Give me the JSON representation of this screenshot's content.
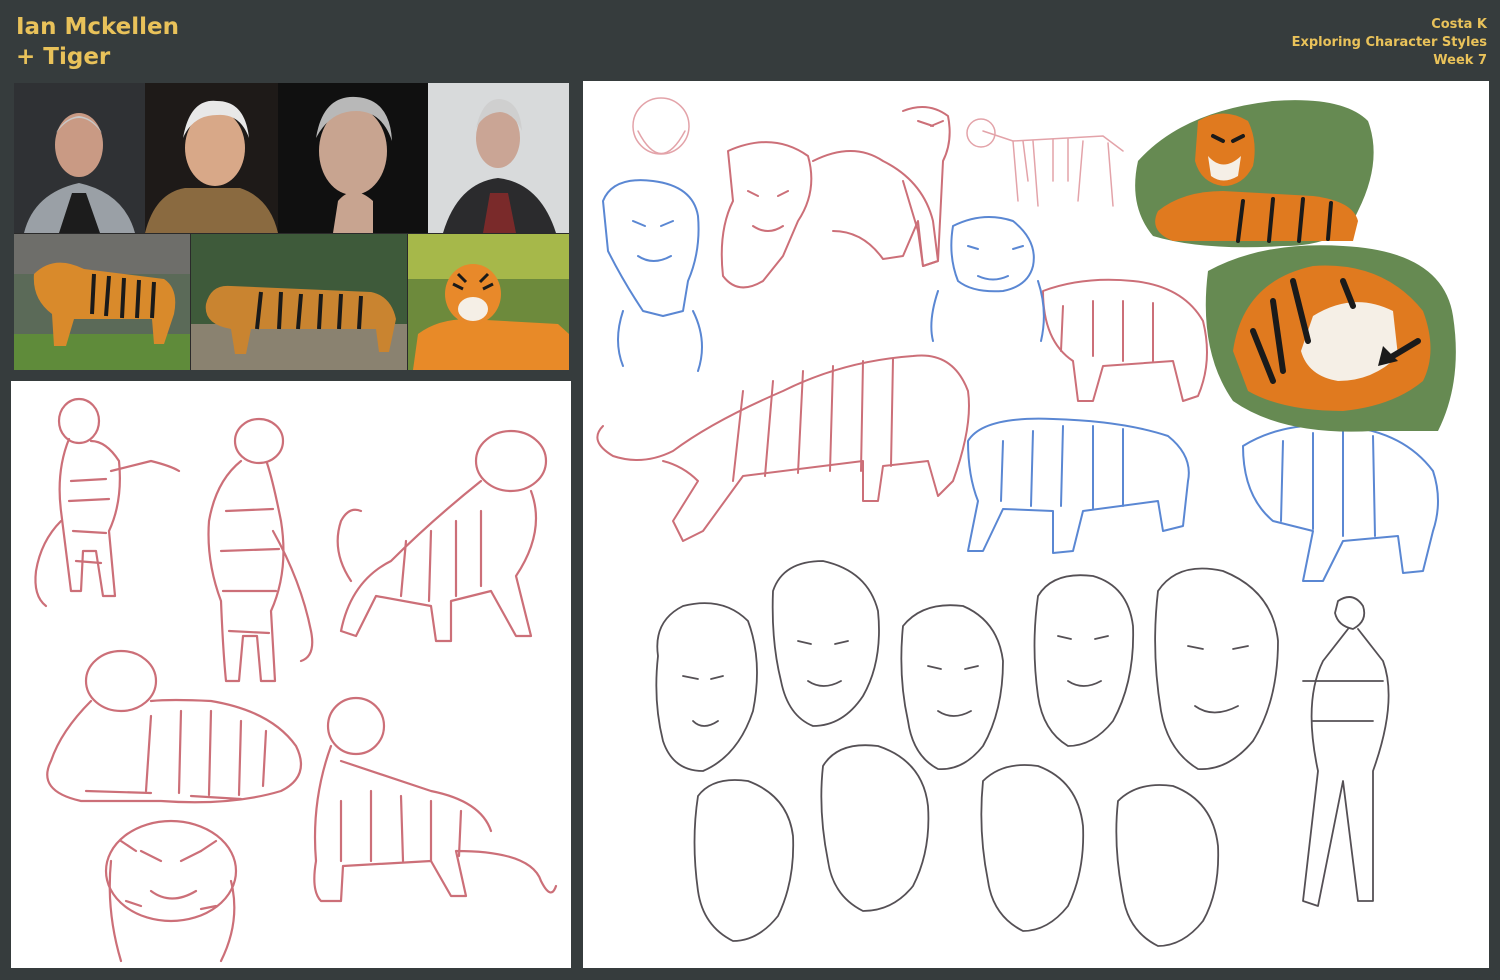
{
  "header": {
    "title_line1": "Ian Mckellen",
    "title_line2": "+ Tiger",
    "credit_author": "Costa K",
    "credit_topic": "Exploring Character Styles",
    "credit_week": "Week 7"
  },
  "colors": {
    "background": "#363c3d",
    "title_gold": "#e9c25a",
    "sketch_red": "#cc6f78",
    "sketch_blue": "#5a87d3",
    "sketch_gray": "#555055",
    "inset_green": "#668a52",
    "tiger_orange": "#e07a1f"
  },
  "reference_photos": {
    "portraits": [
      "portrait-photo-1",
      "portrait-photo-2",
      "portrait-photo-3",
      "portrait-photo-4"
    ],
    "tigers": [
      "tiger-photo-1",
      "tiger-photo-2",
      "tiger-photo-3"
    ]
  }
}
